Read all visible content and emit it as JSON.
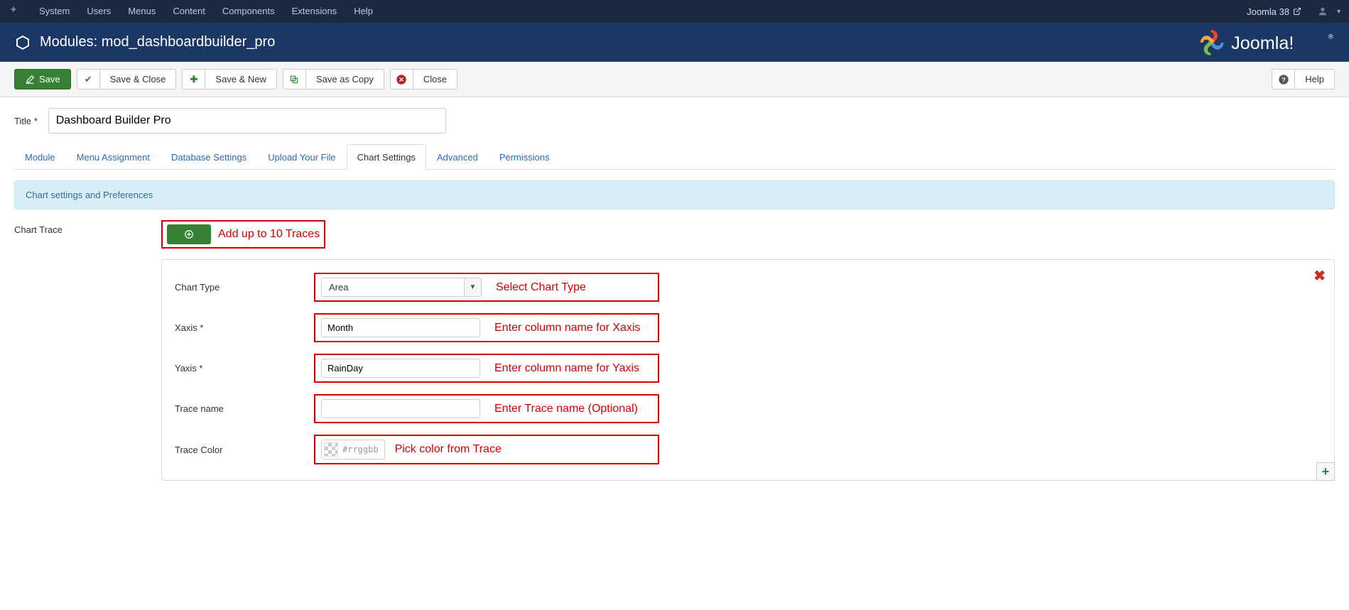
{
  "adminbar": {
    "menu": [
      "System",
      "Users",
      "Menus",
      "Content",
      "Components",
      "Extensions",
      "Help"
    ],
    "site_name": "Joomla 38"
  },
  "header": {
    "title": "Modules: mod_dashboardbuilder_pro",
    "brand": "Joomla!"
  },
  "toolbar": {
    "save": "Save",
    "save_close": "Save & Close",
    "save_new": "Save & New",
    "save_copy": "Save as Copy",
    "close": "Close",
    "help": "Help"
  },
  "form": {
    "title_label": "Title *",
    "title_value": "Dashboard Builder Pro"
  },
  "tabs": [
    "Module",
    "Menu Assignment",
    "Database Settings",
    "Upload Your File",
    "Chart Settings",
    "Advanced",
    "Permissions"
  ],
  "active_tab": "Chart Settings",
  "infobox": "Chart settings and Preferences",
  "chart_trace_label": "Chart Trace",
  "annotations": {
    "add_traces": "Add up to 10 Traces",
    "chart_type": "Select Chart Type",
    "xaxis": "Enter column name for Xaxis",
    "yaxis": "Enter column name for Yaxis",
    "trace_name": "Enter Trace name (Optional)",
    "trace_color": "Pick color from Trace"
  },
  "trace": {
    "chart_type_label": "Chart Type",
    "chart_type_value": "Area",
    "xaxis_label": "Xaxis *",
    "xaxis_value": "Month",
    "yaxis_label": "Yaxis *",
    "yaxis_value": "RainDay",
    "trace_name_label": "Trace name",
    "trace_name_value": "",
    "trace_color_label": "Trace Color",
    "trace_color_placeholder": "#rrggbb"
  }
}
